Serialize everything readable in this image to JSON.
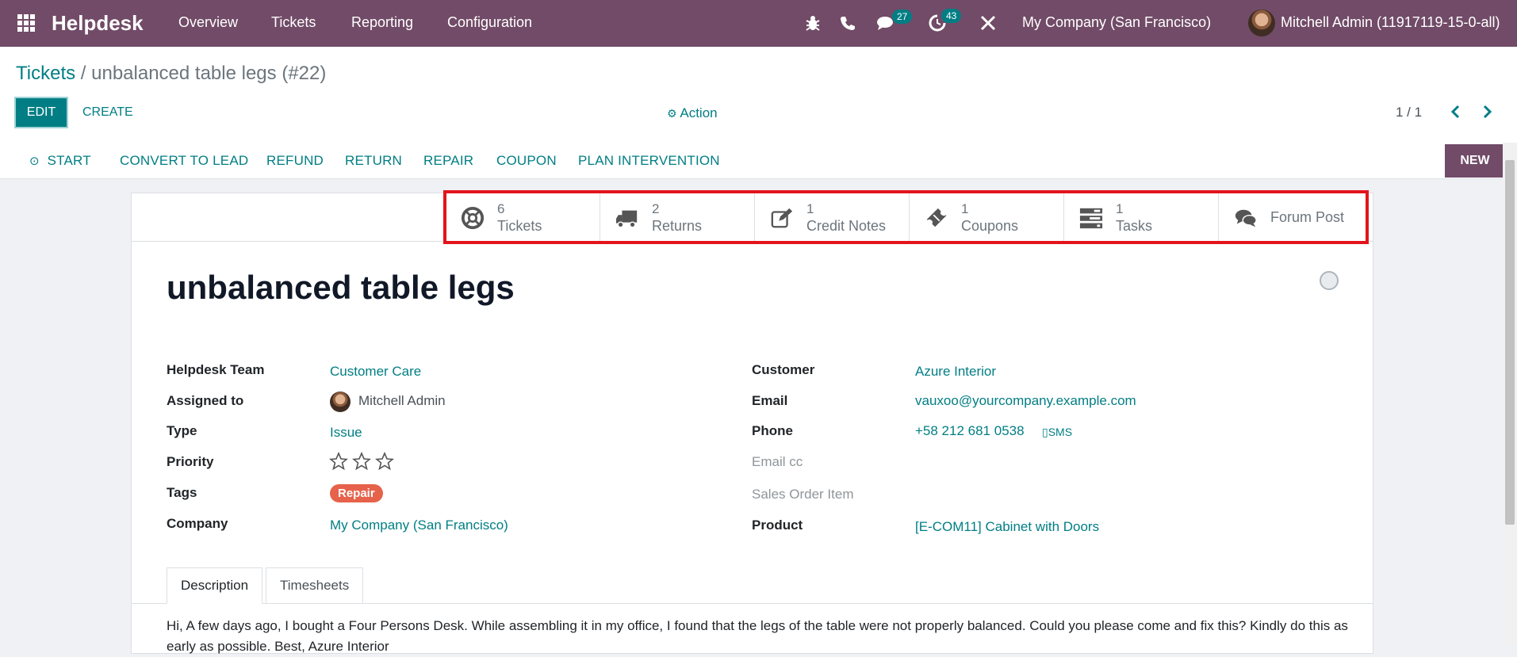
{
  "navbar": {
    "brand": "Helpdesk",
    "menus": [
      "Overview",
      "Tickets",
      "Reporting",
      "Configuration"
    ],
    "messages_count": "27",
    "activities_count": "43",
    "company": "My Company (San Francisco)",
    "user": "Mitchell Admin (11917119-15-0-all)"
  },
  "control": {
    "breadcrumb_root": "Tickets",
    "breadcrumb_current": "/ unbalanced table legs (#22)",
    "edit_label": "EDIT",
    "create_label": "CREATE",
    "action_label": "Action",
    "pager": "1 / 1"
  },
  "statusbar": {
    "buttons": [
      "START",
      "CONVERT TO LEAD",
      "REFUND",
      "RETURN",
      "REPAIR",
      "COUPON",
      "PLAN INTERVENTION"
    ],
    "new_label": "NEW"
  },
  "smart_buttons": [
    {
      "count": "6",
      "label": "Tickets",
      "icon": "lifebuoy-icon"
    },
    {
      "count": "2",
      "label": "Returns",
      "icon": "truck-icon"
    },
    {
      "count": "1",
      "label": "Credit Notes",
      "icon": "pencil-square-icon"
    },
    {
      "count": "1",
      "label": "Coupons",
      "icon": "ticket-icon"
    },
    {
      "count": "1",
      "label": "Tasks",
      "icon": "tasks-icon"
    },
    {
      "count": "",
      "label": "Forum Post",
      "icon": "comments-icon"
    }
  ],
  "ticket": {
    "title": "unbalanced table legs",
    "left_fields": {
      "team_label": "Helpdesk Team",
      "team": "Customer Care",
      "assigned_label": "Assigned to",
      "assigned": "Mitchell Admin",
      "type_label": "Type",
      "type": "Issue",
      "priority_label": "Priority",
      "priority_stars": 0,
      "tags_label": "Tags",
      "tag": "Repair",
      "company_label": "Company",
      "company": "My Company (San Francisco)"
    },
    "right_fields": {
      "customer_label": "Customer",
      "customer": "Azure Interior",
      "email_label": "Email",
      "email": "vauxoo@yourcompany.example.com",
      "phone_label": "Phone",
      "phone": "+58 212 681 0538",
      "sms": "SMS",
      "email_cc_label": "Email cc",
      "sales_order_label": "Sales Order Item",
      "product_label": "Product",
      "product": "[E-COM11] Cabinet with Doors"
    },
    "tabs": [
      "Description",
      "Timesheets"
    ],
    "description": "Hi, A few days ago, I bought a Four Persons Desk. While assembling it in my office, I found that the legs of the table were not properly balanced. Could you please come and fix this? Kindly do this as early as possible. Best, Azure Interior"
  },
  "colors": {
    "primary": "#714b67",
    "accent": "#017e84",
    "tag": "#e6624b",
    "highlight": "#e3141b"
  }
}
